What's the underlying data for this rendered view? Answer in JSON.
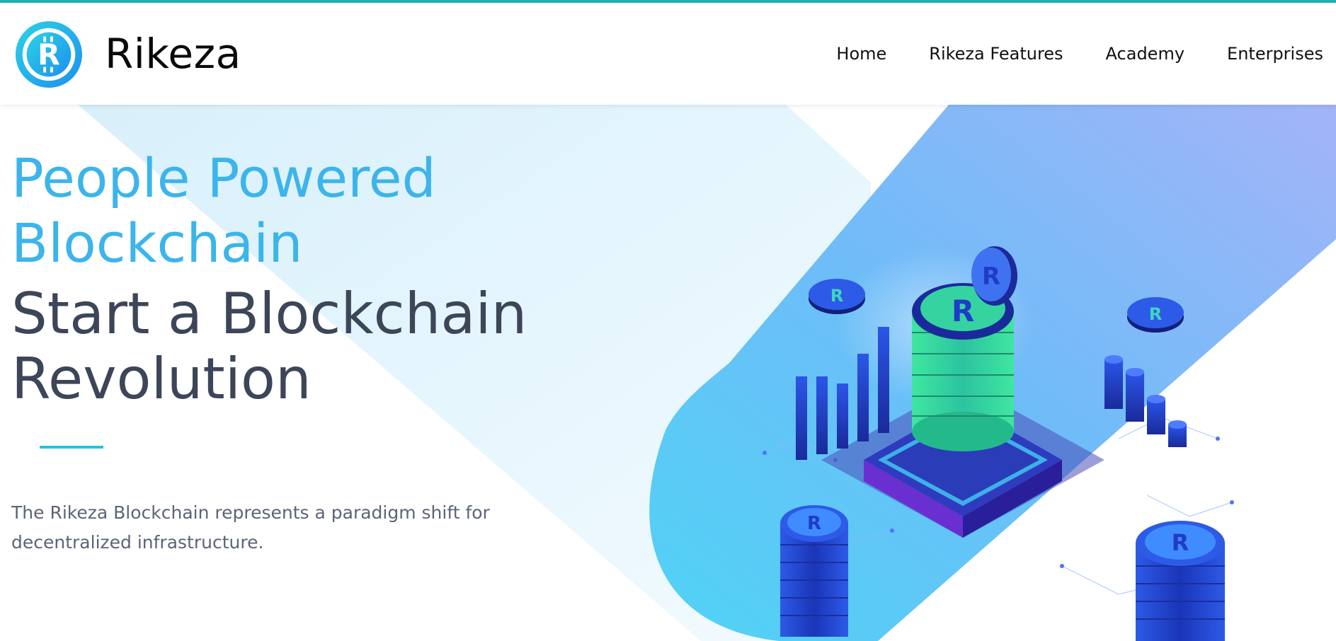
{
  "brand": {
    "name": "Rikeza",
    "logo_icon": "rikeza-coin-logo-icon"
  },
  "nav": {
    "items": [
      {
        "label": "Home"
      },
      {
        "label": "Rikeza Features"
      },
      {
        "label": "Academy"
      },
      {
        "label": "Enterprises"
      }
    ]
  },
  "hero": {
    "headline_line1": "People Powered",
    "headline_line2": "Blockchain",
    "subheadline_line1": "Start a Blockchain",
    "subheadline_line2": "Revolution",
    "description_line1": "The Rikeza Blockchain represents a paradigm shift for",
    "description_line2": "decentralized infrastructure.",
    "illustration": "isometric-blockchain-coins-illustration"
  },
  "colors": {
    "accent": "#3cb4ec",
    "heading_dark": "#3d4658",
    "top_bar": "#1fb0b5",
    "divider": "#1ec6e0",
    "coin_green": "#3fe6a0",
    "coin_blue": "#1f4fd8"
  }
}
